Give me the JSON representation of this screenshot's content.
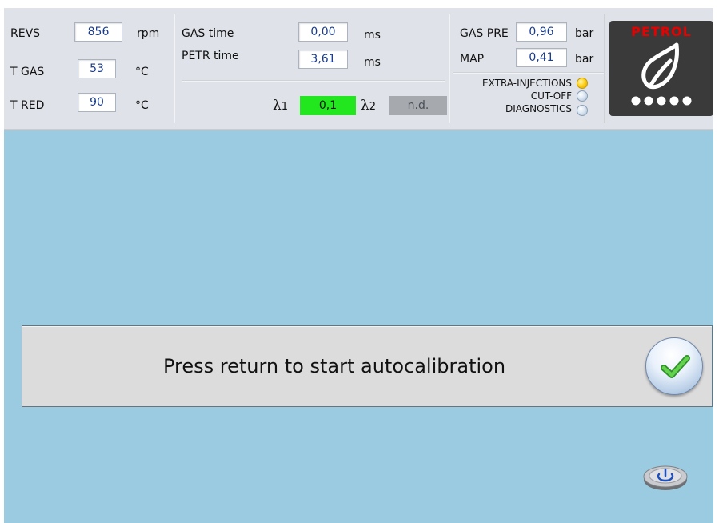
{
  "gauges_left": [
    {
      "label": "REVS",
      "value": "856",
      "unit": "rpm"
    },
    {
      "label": "T GAS",
      "value": "53",
      "unit": "°C"
    },
    {
      "label": "T RED",
      "value": "90",
      "unit": "°C"
    }
  ],
  "times": [
    {
      "label": "GAS time",
      "value": "0,00",
      "unit": "ms"
    },
    {
      "label": "PETR time",
      "value": "3,61",
      "unit": "ms"
    }
  ],
  "lambda": {
    "symbol": "λ",
    "l1_index": "1",
    "l1_value": "0,1",
    "l1_color": "#22e61e",
    "l2_index": "2",
    "l2_value": "n.d.",
    "l2_color": "#a6a9ad"
  },
  "pressures": [
    {
      "label": "GAS PRE",
      "value": "0,96",
      "unit": "bar"
    },
    {
      "label": "MAP",
      "value": "0,41",
      "unit": "bar"
    }
  ],
  "indicators": [
    {
      "label": "EXTRA-INJECTIONS",
      "state": "on",
      "color": "#ffd21a"
    },
    {
      "label": "CUT-OFF",
      "state": "off",
      "color": "#dbe6f1"
    },
    {
      "label": "DIAGNOSTICS",
      "state": "off",
      "color": "#dbe6f1"
    }
  ],
  "fuel_mode": {
    "label": "PETROL",
    "icon": "fuel-drop-icon",
    "dots": 5
  },
  "prompt": {
    "text": "Press return to start autocalibration",
    "confirm_icon": "checkmark-icon"
  },
  "power_button": {
    "icon": "power-icon"
  },
  "colors": {
    "main_background": "#9acbe0",
    "top_background": "#dfe2e8",
    "value_text": "#1a3c8c",
    "logo_red": "#e60000"
  }
}
